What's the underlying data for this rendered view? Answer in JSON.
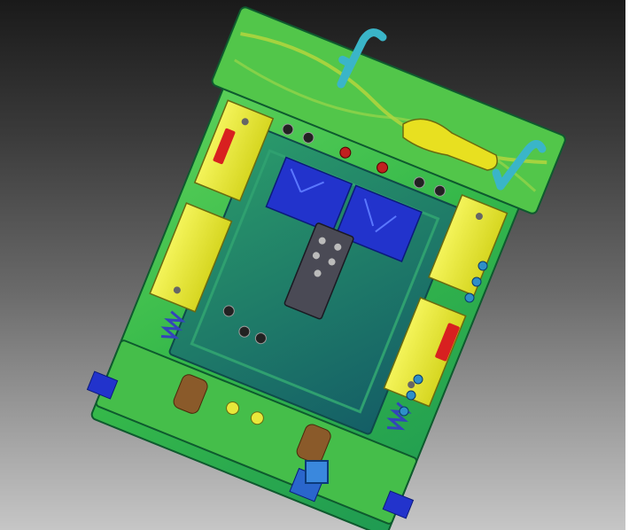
{
  "scene": {
    "description_title": "",
    "colors": {
      "background_top": "#1a1a1a",
      "background_bottom": "#c6c6c6",
      "mold_green": "#3fbf3f",
      "mold_dark_green": "#1f8a4c",
      "cavity_teal": "#1d7a7a",
      "plate_yellow": "#e8e83a",
      "hook_cyan": "#3ab5c8",
      "insert_blue": "#2233cc",
      "accent_red": "#d82020",
      "spring_blue": "#3344bb",
      "bushing_brown": "#8a5a2a"
    },
    "icons": [
      "lifting-hook-icon",
      "spring-icon",
      "ejector-pin-icon",
      "guide-pillar-icon"
    ]
  }
}
